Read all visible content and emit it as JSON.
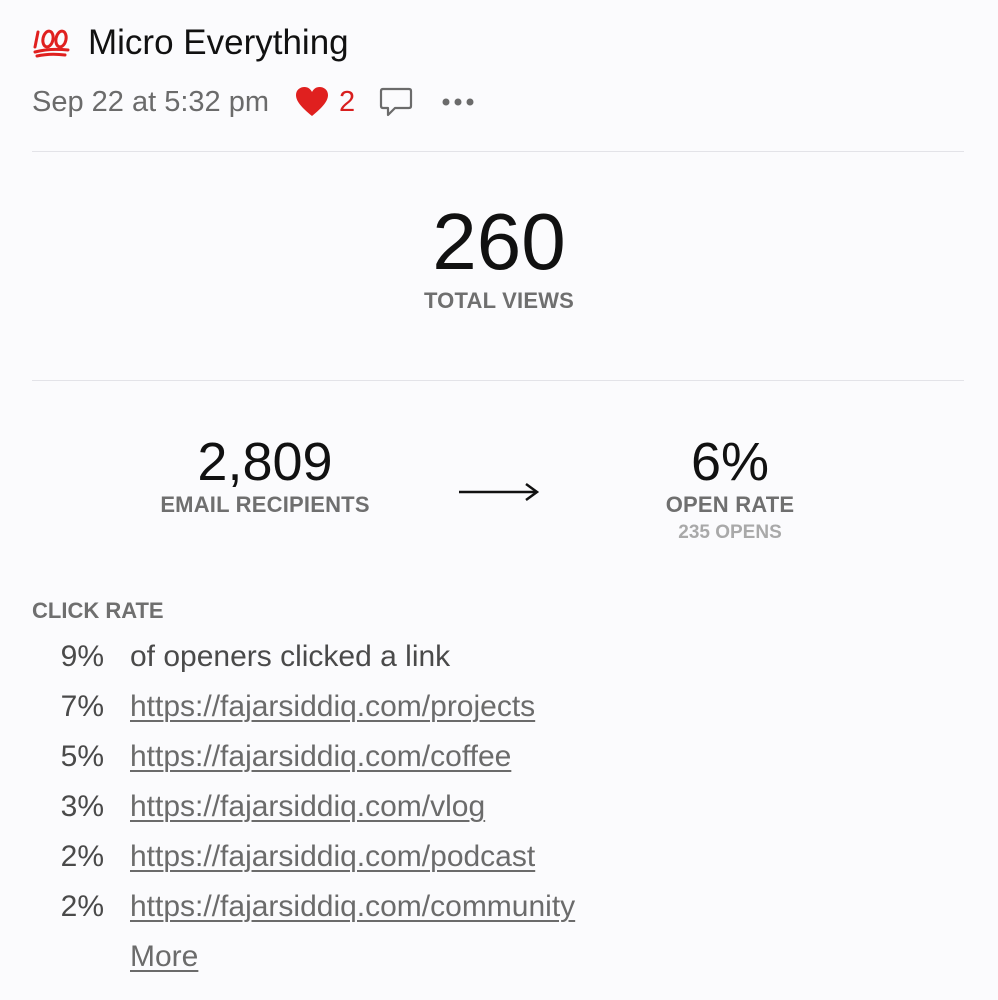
{
  "header": {
    "icon": "hundred-points-icon",
    "title": "Micro Everything"
  },
  "meta": {
    "date": "Sep 22 at 5:32 pm",
    "likes": "2",
    "heart_color": "#e0201f",
    "like_color": "#d81e1e"
  },
  "total_views": {
    "value": "260",
    "label": "TOTAL VIEWS"
  },
  "email": {
    "recipients_value": "2,809",
    "recipients_label": "EMAIL RECIPIENTS",
    "open_rate_value": "6%",
    "open_rate_label": "OPEN RATE",
    "opens": "235 OPENS"
  },
  "click_rate": {
    "title": "CLICK RATE",
    "summary_pct": "9%",
    "summary_text": "of openers clicked a link",
    "links": [
      {
        "pct": "7%",
        "url": "https://fajarsiddiq.com/projects"
      },
      {
        "pct": "5%",
        "url": "https://fajarsiddiq.com/coffee"
      },
      {
        "pct": "3%",
        "url": "https://fajarsiddiq.com/vlog"
      },
      {
        "pct": "2%",
        "url": "https://fajarsiddiq.com/podcast"
      },
      {
        "pct": "2%",
        "url": "https://fajarsiddiq.com/community"
      }
    ],
    "more_label": "More"
  }
}
